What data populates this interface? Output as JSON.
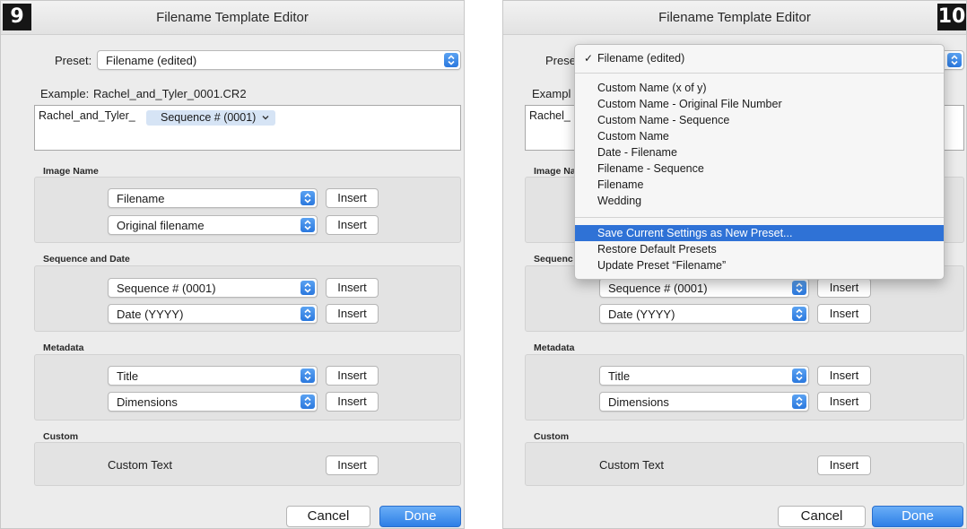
{
  "dialog_title": "Filename Template Editor",
  "steps": [
    "9",
    "10"
  ],
  "preset_label": "Preset:",
  "preset_value": "Filename (edited)",
  "example_label": "Example:",
  "example_value": "Rachel_and_Tyler_0001.CR2",
  "template": {
    "prefix_text": "Rachel_and_Tyler_",
    "token_label": "Sequence # (0001)"
  },
  "sections": {
    "image_name": {
      "label": "Image Name",
      "rows": [
        {
          "select": "Filename",
          "button": "Insert"
        },
        {
          "select": "Original filename",
          "button": "Insert"
        }
      ]
    },
    "sequence_date": {
      "label": "Sequence and Date",
      "rows": [
        {
          "select": "Sequence # (0001)",
          "button": "Insert"
        },
        {
          "select": "Date (YYYY)",
          "button": "Insert"
        }
      ]
    },
    "metadata": {
      "label": "Metadata",
      "rows": [
        {
          "select": "Title",
          "button": "Insert"
        },
        {
          "select": "Dimensions",
          "button": "Insert"
        }
      ]
    },
    "custom": {
      "label": "Custom",
      "text_label": "Custom Text",
      "button": "Insert"
    }
  },
  "buttons": {
    "cancel": "Cancel",
    "done": "Done"
  },
  "right_truncated": {
    "preset": "Prese",
    "example": "Exampl",
    "prefix": "Rachel_",
    "image_name": "Image Na",
    "sequence": "Sequenc"
  },
  "preset_menu": {
    "checked_item": "Filename (edited)",
    "presets": [
      "Custom Name (x of y)",
      "Custom Name - Original File Number",
      "Custom Name - Sequence",
      "Custom Name",
      "Date - Filename",
      "Filename - Sequence",
      "Filename",
      "Wedding"
    ],
    "actions": [
      "Save Current Settings as New Preset...",
      "Restore Default Presets",
      "Update Preset “Filename”"
    ],
    "highlighted_action": "Save Current Settings as New Preset..."
  },
  "colors": {
    "accent_blue": "#2f72d6",
    "token_fill": "#d6e4f5",
    "dialog_bg": "#ececec"
  }
}
